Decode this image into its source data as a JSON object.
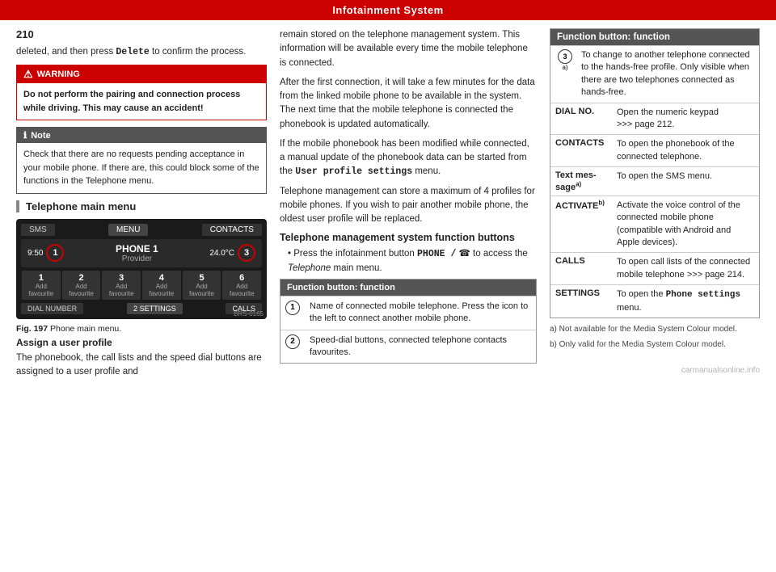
{
  "topbar": {
    "title": "Infotainment System"
  },
  "page_number": "210",
  "left": {
    "intro_text": "deleted, and then press Delete to confirm the process.",
    "warning": {
      "header": "WARNING",
      "body": "Do not perform the pairing and connection process while driving. This may cause an accident!"
    },
    "note": {
      "header": "Note",
      "body": "Check that there are no requests pending acceptance in your mobile phone. If there are, this could block some of the functions in the Telephone menu."
    },
    "section_title": "Telephone main menu",
    "phone_ui": {
      "tab_sms": "SMS",
      "tab_menu": "MENU",
      "tab_contacts": "CONTACTS",
      "time": "9:50",
      "circle1": "1",
      "phone_name": "PHONE 1",
      "provider": "Provider",
      "temp": "24.0°C",
      "circle3": "3",
      "buttons": [
        "1",
        "2",
        "3",
        "4",
        "5",
        "6"
      ],
      "btn_labels": [
        "Add favourite",
        "Add favourite",
        "Add favourite",
        "Add favourite",
        "Add favourite",
        "Add favourite"
      ],
      "circle2": "2",
      "bottom_dial": "DIAL NUMBER",
      "bottom_settings": "SETTINGS",
      "bottom_calls": "CALLS",
      "barcode": "BRS-0165"
    },
    "fig_label": "Fig. 197",
    "fig_caption": "Phone main menu.",
    "assign_title": "Assign a user profile",
    "assign_text": "The phonebook, the call lists and the speed dial buttons are assigned to a user profile and"
  },
  "mid": {
    "para1": "remain stored on the telephone management system. This information will be available every time the mobile telephone is connected.",
    "para2": "After the first connection, it will take a few minutes for the data from the linked mobile phone to be available in the system. The next time that the mobile telephone is connected the phonebook is updated automatically.",
    "para3": "If the mobile phonebook has been modified while connected, a manual update of the phonebook data can be started from the User profile settings menu.",
    "para4": "Telephone management can store a maximum of 4 profiles for mobile phones. If you wish to pair another mobile phone, the oldest user profile will be replaced.",
    "section_title": "Telephone management system function buttons",
    "bullet": "Press the infotainment button PHONE / ☎ to access the Telephone main menu.",
    "function_table": {
      "header": "Function button: function",
      "rows": [
        {
          "num": "1",
          "desc": "Name of connected mobile telephone. Press the icon to the left to connect another mobile phone."
        },
        {
          "num": "2",
          "desc": "Speed-dial buttons, connected telephone contacts favourites."
        }
      ]
    }
  },
  "right": {
    "function_table": {
      "header": "Function button: function",
      "rows": [
        {
          "label": "③ᵃ⧉",
          "label_text": "3",
          "label_sup": "a)",
          "desc": "To change to another telephone connected to the hands-free profile. Only visible when there are two telephones connected as hands-free."
        },
        {
          "label": "DIAL NO.",
          "desc": "Open the numeric keypad ››› page 212."
        },
        {
          "label": "CONTACTS",
          "desc": "To open the phonebook of the connected telephone."
        },
        {
          "label": "Text mes-sageᵃ⧉",
          "label_text": "Text mes-sage",
          "label_sup": "a)",
          "desc": "To open the SMS menu."
        },
        {
          "label": "ACTIVATE",
          "label_sup": "b)",
          "desc": "Activate the voice control of the connected mobile phone (compatible with Android and Apple devices)."
        },
        {
          "label": "CALLS",
          "desc": "To open call lists of the connected mobile telephone ››› page 214."
        },
        {
          "label": "SETTINGS",
          "desc": "To open the Phone settings menu."
        }
      ]
    },
    "footnote_a": "a) Not available for the Media System Colour model.",
    "footnote_b": "b) Only valid for the Media System Colour model."
  }
}
